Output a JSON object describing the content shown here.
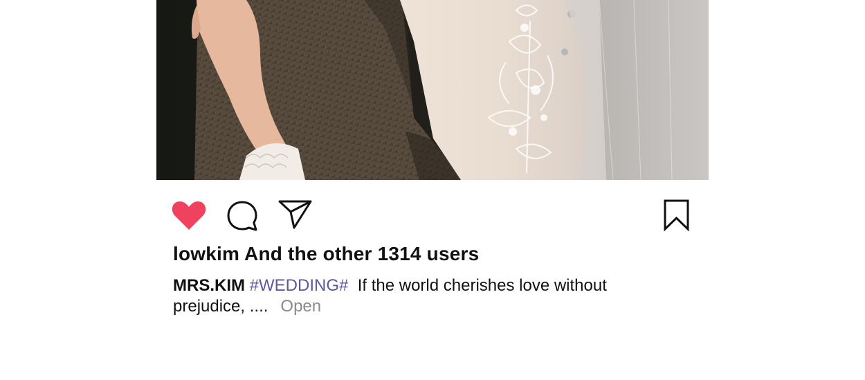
{
  "post": {
    "photo_alt": "Couple embrace: suit and lace wedding dress with veil",
    "actions": {
      "like_icon": "heart-filled-icon",
      "comment_icon": "speech-bubble-icon",
      "share_icon": "paper-plane-icon",
      "bookmark_icon": "bookmark-icon",
      "like_color": "#f0415f"
    },
    "likes_text": "lowkim And the other 1314 users",
    "caption": {
      "username": "MRS.KIM",
      "hashtag": "#WEDDING#",
      "text_line1": "If the world cherishes love without",
      "text_line2": "prejudice, ....",
      "more_label": "Open"
    }
  }
}
